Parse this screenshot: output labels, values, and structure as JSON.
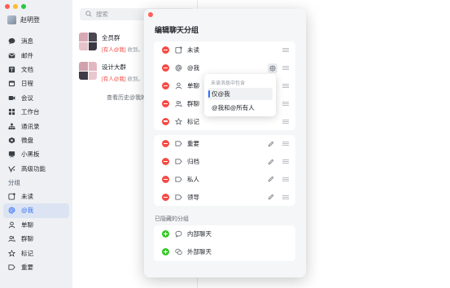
{
  "sidebar": {
    "user_name": "赵明登",
    "items": [
      {
        "label": "消息",
        "icon": "chat-bubble-icon"
      },
      {
        "label": "邮件",
        "icon": "mail-icon"
      },
      {
        "label": "文档",
        "icon": "document-icon"
      },
      {
        "label": "日程",
        "icon": "calendar-icon"
      },
      {
        "label": "会议",
        "icon": "video-icon"
      },
      {
        "label": "工作台",
        "icon": "grid-icon"
      },
      {
        "label": "通讯录",
        "icon": "contacts-icon"
      },
      {
        "label": "微盘",
        "icon": "drive-icon"
      },
      {
        "label": "小黑板",
        "icon": "board-icon"
      },
      {
        "label": "高级功能",
        "icon": "sparkle-icon"
      }
    ],
    "group_section_label": "分组",
    "groups": [
      {
        "label": "未读",
        "icon": "unread-icon"
      },
      {
        "label": "@我",
        "icon": "at-icon",
        "active": true
      },
      {
        "label": "单聊",
        "icon": "person-icon"
      },
      {
        "label": "群聊",
        "icon": "group-icon"
      },
      {
        "label": "标记",
        "icon": "star-icon"
      },
      {
        "label": "重要",
        "icon": "tag-icon"
      }
    ]
  },
  "chatlist": {
    "search_placeholder": "搜索",
    "chats": [
      {
        "title": "全员群",
        "mention": "[有人@我]",
        "preview": " 收到。"
      },
      {
        "title": "设计大群",
        "mention": "[有人@我]",
        "preview": " 收到。"
      }
    ],
    "history_link": "查看历史@我的"
  },
  "modal": {
    "title": "编辑聊天分组",
    "default_groups": [
      {
        "label": "未读",
        "icon": "unread-icon"
      },
      {
        "label": "@我",
        "icon": "at-icon",
        "has_settings": true
      },
      {
        "label": "单聊",
        "icon": "person-icon"
      },
      {
        "label": "群聊",
        "icon": "group-icon"
      },
      {
        "label": "标记",
        "icon": "star-icon"
      }
    ],
    "custom_groups": [
      {
        "label": "重要",
        "icon": "tag-icon"
      },
      {
        "label": "归档",
        "icon": "tag-icon"
      },
      {
        "label": "私人",
        "icon": "tag-icon"
      },
      {
        "label": "领导",
        "icon": "tag-icon"
      }
    ],
    "hidden_section_label": "已隐藏的分组",
    "hidden_groups": [
      {
        "label": "内部聊天",
        "icon": "chat-bubble-icon"
      },
      {
        "label": "外部聊天",
        "icon": "external-chat-icon"
      }
    ]
  },
  "dropdown": {
    "title": "未读消息中包含",
    "options": [
      {
        "label": "仅@我",
        "selected": true
      },
      {
        "label": "@我和@所有人",
        "selected": false
      }
    ]
  },
  "colors": {
    "accent": "#3370ff",
    "remove": "#f54a45",
    "add": "#34c724",
    "mention": "#f54a45"
  }
}
